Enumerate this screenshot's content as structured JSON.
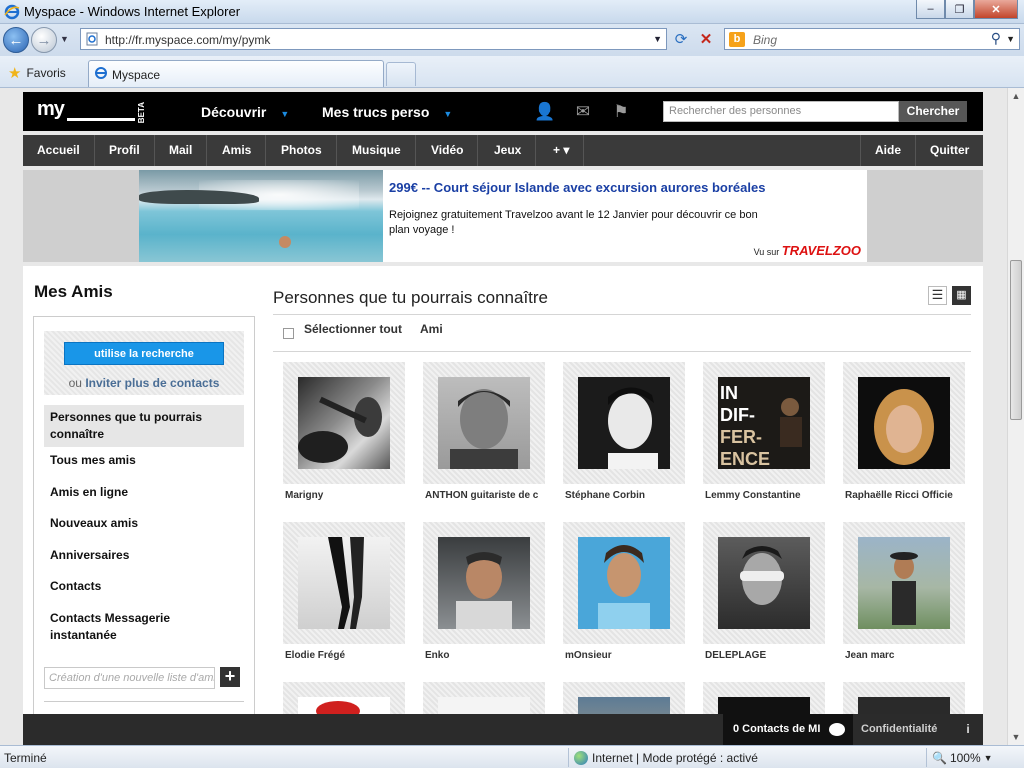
{
  "window": {
    "title": "Myspace - Windows Internet Explorer",
    "minimize": "–",
    "maximize": "❐",
    "close": "✕"
  },
  "browser": {
    "url": "http://fr.myspace.com/my/pymk",
    "search_placeholder": "Bing",
    "favorites_label": "Favoris",
    "tab_title": "Myspace"
  },
  "myspace": {
    "logo": "my",
    "beta": "BETA",
    "nav_primary": [
      {
        "label": "Découvrir"
      },
      {
        "label": "Mes trucs perso"
      }
    ],
    "search_placeholder": "Rechercher des personnes",
    "search_button": "Chercher",
    "nav_secondary": [
      "Accueil",
      "Profil",
      "Mail",
      "Amis",
      "Photos",
      "Musique",
      "Vidéo",
      "Jeux",
      "+ ▾"
    ],
    "nav_right": [
      "Aide",
      "Quitter"
    ]
  },
  "ad": {
    "title": "299€ -- Court séjour Islande avec excursion aurores boréales",
    "body": "Rejoignez gratuitement Travelzoo avant le 12 Janvier pour découvrir ce bon plan voyage !",
    "vu_sur": "Vu sur",
    "brand": "TRAVELZOO"
  },
  "sidebar": {
    "title": "Mes Amis",
    "search_button": "utilise la recherche",
    "invite_prefix": "ou",
    "invite_link": "Inviter plus de contacts",
    "items": [
      {
        "label": "Personnes que tu pourrais connaître",
        "selected": true
      },
      {
        "label": "Tous mes amis"
      },
      {
        "label": "Amis en ligne"
      },
      {
        "label": "Nouveaux amis"
      },
      {
        "label": "Anniversaires"
      },
      {
        "label": "Contacts"
      },
      {
        "label": "Contacts Messagerie instantanée"
      }
    ],
    "new_list_placeholder": "Création d'une nouvelle liste d'amis",
    "add_symbol": "+"
  },
  "main": {
    "title": "Personnes que tu pourrais connaître",
    "select_all": "Sélectionner tout",
    "column_ami": "Ami",
    "people": [
      {
        "name": "Marigny"
      },
      {
        "name": "ANTHON guitariste de c"
      },
      {
        "name": "Stéphane Corbin"
      },
      {
        "name": "Lemmy Constantine"
      },
      {
        "name": "Raphaëlle Ricci Officie"
      },
      {
        "name": "Elodie Frégé"
      },
      {
        "name": "Enko"
      },
      {
        "name": "mOnsieur"
      },
      {
        "name": "DELEPLAGE"
      },
      {
        "name": "Jean marc"
      }
    ],
    "album_text": "IN DIF- FER- ENCE"
  },
  "footer": {
    "im_contacts": "0 Contacts de MI",
    "privacy": "Confidentialité",
    "info": "i"
  },
  "status": {
    "text": "Terminé",
    "zone": "Internet | Mode protégé : activé",
    "zoom": "100%"
  }
}
